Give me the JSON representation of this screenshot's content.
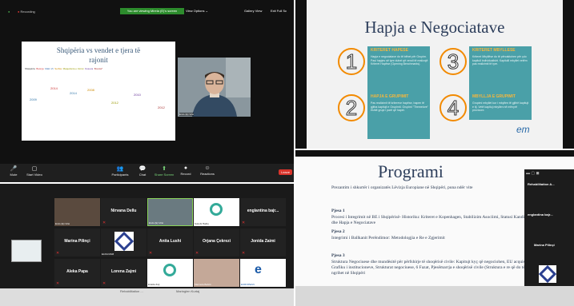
{
  "zoom_top": {
    "recording": "Recording",
    "banner": "You are viewing Mirela (E)'s screen",
    "view_options": "View Options ⌄",
    "gallery_view": "Gallery View",
    "exit": "Exit Full Sc",
    "slide_title_1": "Shqipëria vs vendet e tjera të",
    "slide_title_2": "rajonit",
    "slide_countries": [
      "Shqipëria",
      "Bosnja",
      "Mali i Zi",
      "Serbia",
      "Maqedonia e Veriut",
      "Kosova",
      "Bosnia*"
    ],
    "slide_years": [
      "2009",
      "2014",
      "2014",
      "2008",
      "2012",
      "2010",
      "2012"
    ],
    "cam_name": "Ervis (E) Vrisi",
    "toolbar": [
      [
        "🎤",
        "Mute"
      ],
      [
        "▢",
        "Start Video"
      ],
      [
        "👥",
        "Participants"
      ],
      [
        "💬",
        "Chat"
      ],
      [
        "⬆",
        "Share Screen"
      ],
      [
        "●",
        "Record"
      ],
      [
        "☺",
        "Reactions"
      ]
    ],
    "leave": "Leave"
  },
  "slide_hapja": {
    "title": "Hapja e Negociatave",
    "c1_title": "KRITERET HAPESE",
    "c1_text": "Hapja e negociatave do të bëhet për Grupim. Pasi hapjes së tyre duhet që vendi të realizojë Kriteret Hapëse (Opening Benchmarks).",
    "c2_title": "HAPJA E GRUPIMIT",
    "c2_text": "Pas realizimit të kritereve hapëse, hapen të gjitha kapitujt e Grupimit. Grupimi \"Themelore\" është grupi i parë që hapet.",
    "c3_title": "KRITERET MBYLLESE",
    "c3_text": "Kriteret Mbyllëse do të përcaktohen për çdo kapitull individualisht. Kapitulli mbyllet vetëm pas realizimit të tyre.",
    "c4_title": "MBYLLJA E GRUPIMIT",
    "c4_text": "Grupimi mbyllet kur i mbyllen të gjithë kapitujt e tij. Vetë kapituj mbyllen në mënyrë provizore.",
    "logo": "em"
  },
  "gallery": {
    "participants": [
      {
        "name": "Nirvana Dellu",
        "label": ""
      },
      {
        "name": "",
        "label": "Ervis (E) Vrisi"
      },
      {
        "name": "",
        "label": "Sokobr Balikj"
      },
      {
        "name": "englantina bajr...",
        "label": ""
      },
      {
        "name": "Marina Pilinçi",
        "label": ""
      },
      {
        "name": "",
        "label": "ELDA RAM"
      },
      {
        "name": "Anita Lushi",
        "label": ""
      },
      {
        "name": "Orjana Çekrezi",
        "label": ""
      },
      {
        "name": "Jonida Zaimi",
        "label": ""
      },
      {
        "name": "Aleka Papa",
        "label": ""
      },
      {
        "name": "Lorena Zajmi",
        "label": ""
      },
      {
        "name": "",
        "label": "Eralda Zulj"
      },
      {
        "name": "",
        "label": "Marinela Bahriii"
      },
      {
        "name": "",
        "label": "EUROPEAN"
      }
    ],
    "bottom_names": [
      "Rehabilitation ...",
      "Maringlen Kurtaj"
    ]
  },
  "slide_programi": {
    "title": "Programi",
    "intro": "Prezantim i shkurtër i organizatës Lëvizja Europiane në Shqipëri, puna ndër vite",
    "p1_head": "Pjesa 1",
    "p1_body": "Procesi i Integrimit në BE i Shqipërisë- Historiku: Kriteret e Kopenhagen, Stabilizim Asociimi, Statusi Kandidat dhe Hapja e Negociatave",
    "p2_head": "Pjesa 2",
    "p2_body": "Integrimi i Ballkanit Perëndimor: Metodologjia e Re e Zgjerimit",
    "p3_head": "Pjesa 3",
    "p3_body": "Struktura Negociuese dhe mundësitë për përfshirje të shoqërisë civile: Kapitujt kyç që negociohen, EU acquis , Grafiku i institucioneve, Strukturat negociuese, 6 Fazat, Pjesëmarrja e shoqërisë civile (Struktura e re që do të ngrihet në Shqipëri",
    "side_names": [
      "Rehabilitation A...",
      "englantina bajr...",
      "Marina Pilinçi"
    ]
  },
  "colors": {
    "accent_orange": "#f28a00",
    "slide_blue": "#2e3f5c",
    "zoom_green": "#2d8c2d",
    "mute_red": "#e03030"
  }
}
